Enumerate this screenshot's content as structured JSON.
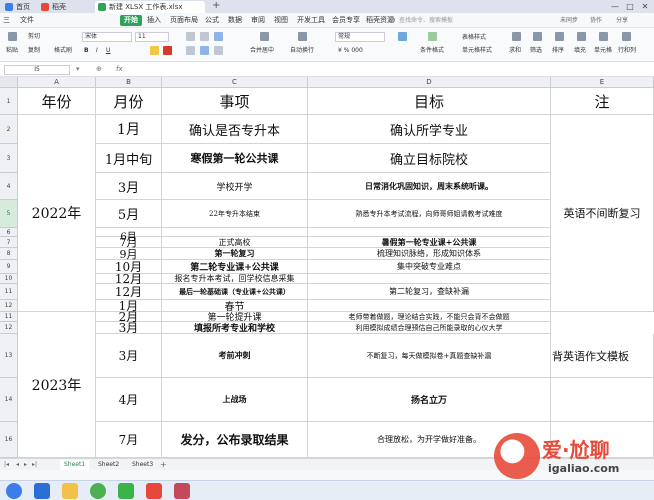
{
  "tabs": [
    {
      "label": "首页",
      "color": "#3b7de9"
    },
    {
      "label": "稻壳",
      "color": "#e8483a"
    },
    {
      "label": "新建 XLSX 工作表.xlsx",
      "color": "#2fa35a"
    }
  ],
  "menu": {
    "items": [
      "三",
      "文件",
      "开始",
      "插入",
      "页面布局",
      "公式",
      "数据",
      "审阅",
      "视图",
      "开发工具",
      "会员专享",
      "稻壳资源"
    ],
    "search": "查找命令、搜索模板",
    "right": [
      "未同步",
      "协作",
      "分享"
    ]
  },
  "ribbon": {
    "paste": "粘贴",
    "cut": "剪切",
    "copy": "复制",
    "format_painter": "格式刷",
    "font_name": "宋体",
    "font_size": "11",
    "merge": "合并居中",
    "wrap": "自动换行",
    "number_format": "常规",
    "conditional": "条件格式",
    "table_style": "表格样式",
    "cell_style": "单元格样式",
    "sum": "求和",
    "filter": "筛选",
    "sort": "排序",
    "fill": "填充",
    "cells": "单元格",
    "rows_cols": "行和列",
    "worksheet": "工作表"
  },
  "formula_bar": {
    "name_box": "I5",
    "fx": "fx"
  },
  "columns": [
    "A",
    "B",
    "C",
    "D",
    "E"
  ],
  "rows": [
    "1",
    "2",
    "3",
    "4",
    "5",
    "6",
    "7",
    "8",
    "9",
    "10",
    "11",
    "12",
    "11",
    "12",
    "13",
    "14",
    "15",
    "16"
  ],
  "cells": {
    "h_year": "年份",
    "h_month": "月份",
    "h_item": "事项",
    "h_goal": "目标",
    "h_note": "注",
    "y2022": "2022年",
    "y2023": "2023年",
    "r2_b": "1月",
    "r2_c": "确认是否专升本",
    "r2_d": "确认所学专业",
    "r3_b": "1月中旬",
    "r3_c": "寒假第一轮公共课",
    "r3_d": "确立目标院校",
    "r4_b": "3月",
    "r4_c": "学校开学",
    "r4_d": "日常消化巩固知识，周末系统听课。",
    "r5_b": "5月",
    "r5_c": "22年专升本结束",
    "r5_d": "熟悉专升本考试流程，向师哥师姐请教考试难度",
    "r6_b": "6月",
    "r7_b": "7月",
    "r7_c": "正式高校",
    "r7_d": "暑假第一轮专业课+公共课",
    "r8_b": "9月",
    "r8_c": "第一轮复习",
    "r8_d": "梳理知识脉络，形成知识体系",
    "r9_b": "10月",
    "r9_c": "第二轮专业课+公共课",
    "r9_d": "集中突破专业难点",
    "r10_b": "12月",
    "r10_c": "报名专升本考试，回学校信息采集",
    "r11_b": "12月",
    "r11_c": "最后一轮基础课（专业课+公共课）",
    "r11_d": "第二轮复习，查缺补漏",
    "e_2022": "英语不间断复习",
    "r12_b": "1月",
    "r12_c": "春节",
    "r13_b": "2月",
    "r13_c": "第一轮提升课",
    "r13_d": "老师带着做题，理论结合实践，不能只会背不会做题",
    "r14_b": "3月",
    "r14_c": "填报所考专业和学校",
    "r14_d": "利用模拟成绩合理预估自己所能录取的心仪大学",
    "r15_b": "3月",
    "r15_c": "考前冲刺",
    "r15_d": "不断复习，每天做模拟卷+真题查缺补漏",
    "e_2023": "背英语作文模板",
    "r16_b": "4月",
    "r16_c": "上战场",
    "r16_d": "扬名立万",
    "r17_b": "7月",
    "r17_c": "发分，公布录取结果",
    "r17_d": "合理放松，为开学做好准备。"
  },
  "sheets": [
    "Sheet1",
    "Sheet2",
    "Sheet3"
  ],
  "watermark": {
    "text": "爱·尬聊",
    "url": "igaliao.com"
  }
}
